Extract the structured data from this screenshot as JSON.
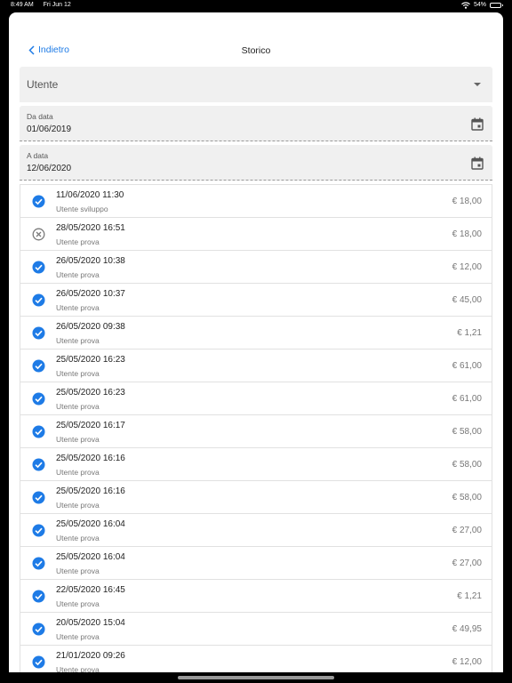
{
  "status_bar": {
    "time": "8:49 AM",
    "date": "Fri Jun 12",
    "battery": "54%",
    "battery_level": 0.54
  },
  "nav": {
    "back_label": "Indietro",
    "title": "Storico"
  },
  "filters": {
    "user_select": {
      "value": "Utente"
    },
    "from_date": {
      "label": "Da data",
      "value": "01/06/2019"
    },
    "to_date": {
      "label": "A data",
      "value": "12/06/2020"
    }
  },
  "colors": {
    "accent": "#1e7be6",
    "check": "#1e7be6",
    "cancel": "#7a7a7a"
  },
  "transactions": [
    {
      "status": "ok",
      "datetime": "11/06/2020 11:30",
      "user": "Utente sviluppo",
      "amount": "€ 18,00"
    },
    {
      "status": "cancelled",
      "datetime": "28/05/2020 16:51",
      "user": "Utente prova",
      "amount": "€ 18,00"
    },
    {
      "status": "ok",
      "datetime": "26/05/2020 10:38",
      "user": "Utente prova",
      "amount": "€ 12,00"
    },
    {
      "status": "ok",
      "datetime": "26/05/2020 10:37",
      "user": "Utente prova",
      "amount": "€ 45,00"
    },
    {
      "status": "ok",
      "datetime": "26/05/2020 09:38",
      "user": "Utente prova",
      "amount": "€ 1,21"
    },
    {
      "status": "ok",
      "datetime": "25/05/2020 16:23",
      "user": "Utente prova",
      "amount": "€ 61,00"
    },
    {
      "status": "ok",
      "datetime": "25/05/2020 16:23",
      "user": "Utente prova",
      "amount": "€ 61,00"
    },
    {
      "status": "ok",
      "datetime": "25/05/2020 16:17",
      "user": "Utente prova",
      "amount": "€ 58,00"
    },
    {
      "status": "ok",
      "datetime": "25/05/2020 16:16",
      "user": "Utente prova",
      "amount": "€ 58,00"
    },
    {
      "status": "ok",
      "datetime": "25/05/2020 16:16",
      "user": "Utente prova",
      "amount": "€ 58,00"
    },
    {
      "status": "ok",
      "datetime": "25/05/2020 16:04",
      "user": "Utente prova",
      "amount": "€ 27,00"
    },
    {
      "status": "ok",
      "datetime": "25/05/2020 16:04",
      "user": "Utente prova",
      "amount": "€ 27,00"
    },
    {
      "status": "ok",
      "datetime": "22/05/2020 16:45",
      "user": "Utente prova",
      "amount": "€ 1,21"
    },
    {
      "status": "ok",
      "datetime": "20/05/2020 15:04",
      "user": "Utente prova",
      "amount": "€ 49,95"
    },
    {
      "status": "ok",
      "datetime": "21/01/2020 09:26",
      "user": "Utente prova",
      "amount": "€ 12,00"
    }
  ]
}
